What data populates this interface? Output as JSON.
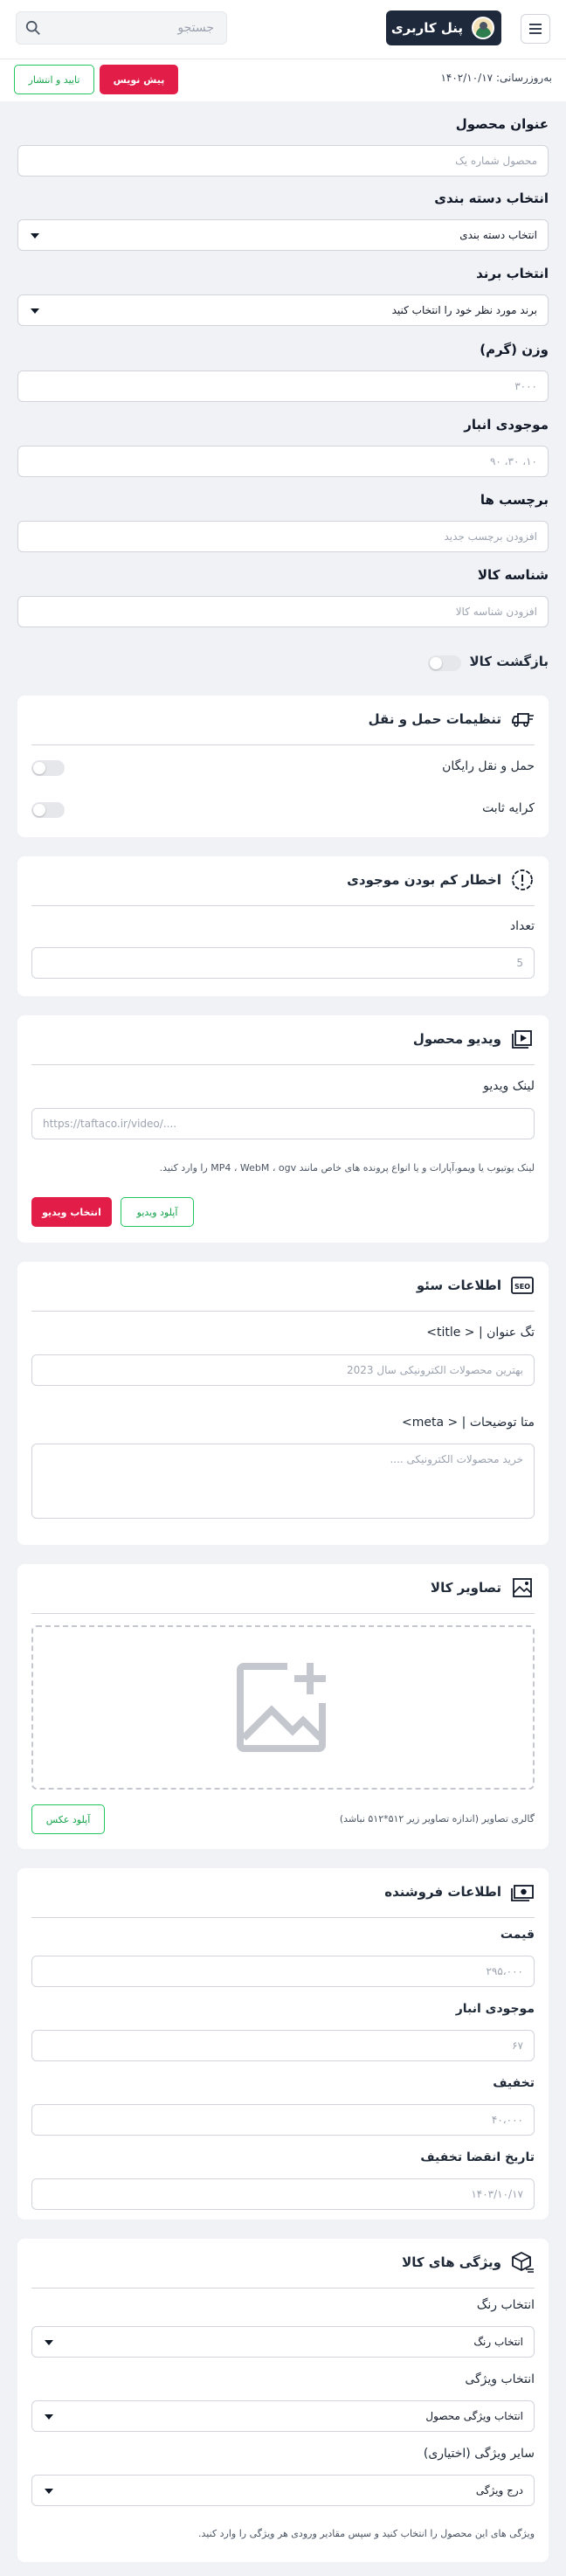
{
  "header": {
    "panel_label": "پنل کاربری",
    "search_placeholder": "جستجو"
  },
  "subbar": {
    "updated": "به‌روزرسانی: ۱۴۰۲/۱۰/۱۷",
    "draft_button": "پیش نویس",
    "publish_button": "تایید و انتشار"
  },
  "form": {
    "title_label": "عنوان محصول",
    "title_placeholder": "محصول شماره یک",
    "category_label": "انتخاب دسته بندی",
    "category_value": "انتخاب دسته بندی",
    "brand_label": "انتخاب برند",
    "brand_value": "برند مورد نظر خود را انتخاب کنید",
    "weight_label": "وزن (گرم)",
    "weight_placeholder": "۳۰۰۰",
    "stock_label": "موجودی انبار",
    "stock_placeholder": "۱۰، ۳۰، ۹۰",
    "tags_label": "برچسب ها",
    "tags_placeholder": "افزودن برچسب جدید",
    "sku_label": "شناسه کالا",
    "sku_placeholder": "افزودن شناسه کالا",
    "return_label": "بازگشت کالا"
  },
  "shipping": {
    "title": "تنظیمات حمل و نقل",
    "free_label": "حمل و نقل رایگان",
    "fixed_label": "کرایه ثابت"
  },
  "low_stock": {
    "title": "اخطار کم بودن موجودی",
    "count_label": "تعداد",
    "count_placeholder": "5"
  },
  "video": {
    "title": "ویدیو محصول",
    "link_label": "لینک ویدیو",
    "link_placeholder": "https://taftaco.ir/video/....",
    "help": "لینک یوتیوب یا ویمو،آپارات و یا انواع پرونده های خاص مانند MP4 ، WebM ، ogv را وارد کنید.",
    "select_button": "انتخاب ویدیو",
    "upload_button": "آپلود ویدیو"
  },
  "seo": {
    "title": "اطلاعات سئو",
    "tag_label": "تگ عنوان | < title>",
    "tag_placeholder": "بهترین محصولات الکترونیکی سال 2023",
    "meta_label": "متا توضیحات | < meta>",
    "meta_placeholder": "خرید محصولات الکترونیکی ...."
  },
  "images": {
    "title": "تصاویر کالا",
    "help": "گالری تصاویر (اندازه تصاویر زیر ۵۱۲*۵۱۲ نباشد)",
    "upload_button": "آپلود عکس"
  },
  "seller": {
    "title": "اطلاعات فروشنده",
    "price_label": "قیمت",
    "price_placeholder": "۲۹۵،۰۰۰",
    "stock_label": "موجودی انبار",
    "stock_placeholder": "۶۷",
    "discount_label": "تخفیف",
    "discount_placeholder": "۴۰،۰۰۰",
    "expire_label": "تاریخ انقضا تخفیف",
    "expire_placeholder": "۱۴۰۳/۱۰/۱۷"
  },
  "features": {
    "title": "ویژگی های کالا",
    "color_label": "انتخاب رنگ",
    "color_value": "انتخاب رنگ",
    "feature_label": "انتخاب ویژگی",
    "feature_value": "انتخاب ویژگی محصول",
    "other_label": "سایر ویژگی (اختیاری)",
    "other_value": "درج ویژگی",
    "help": "ویژگی های این محصول را انتخاب کنید و سپس مقادیر ورودی هر ویژگی را وارد کنید."
  },
  "colors": {
    "accent_red": "#e11d48",
    "accent_green": "#22c55e",
    "header_dark": "#1e293b"
  }
}
